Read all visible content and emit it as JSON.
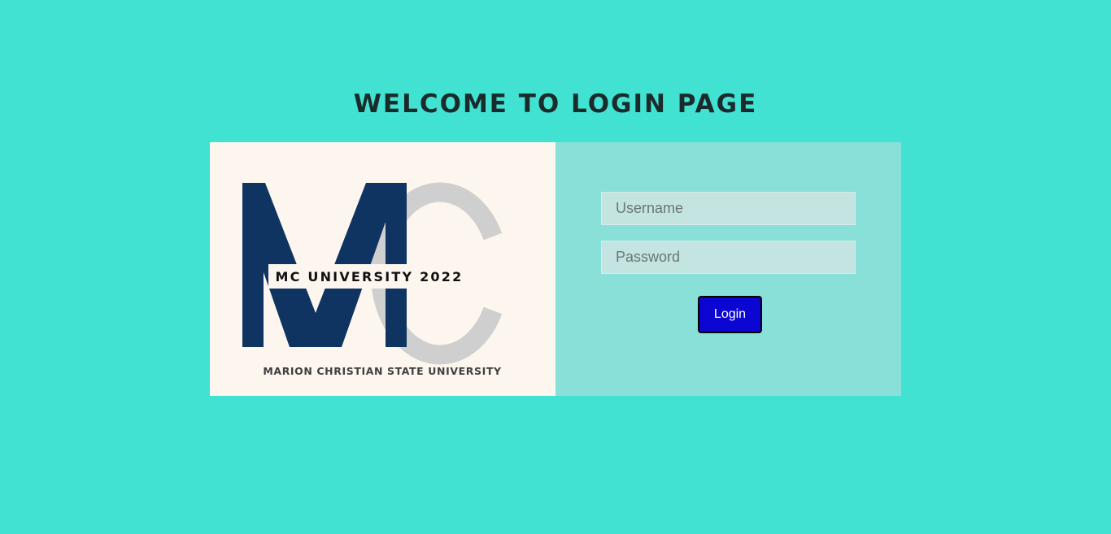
{
  "header": {
    "title": "WELCOME TO LOGIN PAGE"
  },
  "logo": {
    "monogram_m": "M",
    "monogram_c": "C",
    "banner_text": "MC UNIVERSITY 2022",
    "university_name": "MARION CHRISTIAN STATE UNIVERSITY",
    "colors": {
      "navy": "#0f3461",
      "gray": "#cfcfcf",
      "background": "#fdf6ef"
    }
  },
  "form": {
    "username_placeholder": "Username",
    "username_value": "",
    "password_placeholder": "Password",
    "password_value": "",
    "login_label": "Login"
  },
  "colors": {
    "page_background": "#41e2d2",
    "form_panel": "#88e0d8",
    "login_button": "#0b06d1"
  }
}
